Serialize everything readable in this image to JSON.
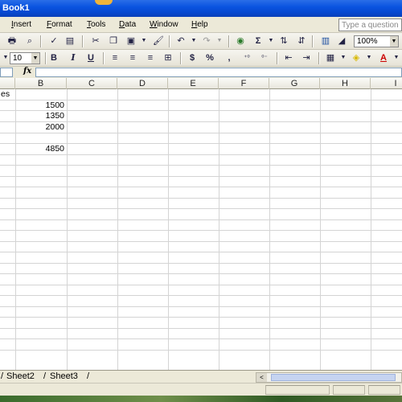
{
  "window": {
    "title": "Book1"
  },
  "menu": {
    "items": [
      "Insert",
      "Format",
      "Tools",
      "Data",
      "Window",
      "Help"
    ],
    "ask_placeholder": "Type a question"
  },
  "toolbar": {
    "zoom": "100%",
    "font_size": "10",
    "bold_label": "B",
    "italic_label": "I",
    "underline_label": "U",
    "currency_label": "$",
    "percent_label": "%",
    "comma_label": ",",
    "autosum_label": "Σ"
  },
  "formula_bar": {
    "fx_label": "fx",
    "value": ""
  },
  "grid": {
    "columns": [
      "B",
      "C",
      "D",
      "E",
      "F",
      "G",
      "H",
      "I"
    ],
    "cells": {
      "a1": "es",
      "b2": "1500",
      "b3": "1350",
      "b4": "2000",
      "b6": "4850"
    }
  },
  "sheets": [
    "Sheet2",
    "Sheet3"
  ],
  "colors": {
    "title_bar": "#0a54e0",
    "chrome": "#ece9d8",
    "gridline": "#d4d4d4"
  }
}
